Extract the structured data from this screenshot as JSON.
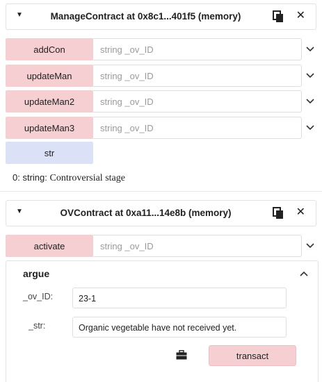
{
  "contract1": {
    "title": "ManageContract at 0x8c1...401f5 (memory)",
    "functions": [
      {
        "label": "addCon",
        "placeholder": "string _ov_ID"
      },
      {
        "label": "updateMan",
        "placeholder": "string _ov_ID"
      },
      {
        "label": "updateMan2",
        "placeholder": "string _ov_ID"
      },
      {
        "label": "updateMan3",
        "placeholder": "string _ov_ID"
      }
    ],
    "call_button": {
      "label": "str"
    },
    "output": {
      "prefix": "0: string:",
      "value": "Controversial  stage"
    }
  },
  "contract2": {
    "title": "OVContract at 0xa11...14e8b (memory)",
    "function": {
      "label": "activate",
      "placeholder": "string _ov_ID"
    },
    "expanded": {
      "name": "argue",
      "params": [
        {
          "label": "_ov_ID:",
          "value": "23-1"
        },
        {
          "label": "_str:",
          "value": "Organic vegetable have not received yet."
        }
      ],
      "transact_label": "transact"
    }
  },
  "icons": {
    "caret": "caret-down-icon",
    "copy": "copy-icon",
    "close": "close-icon",
    "chevron": "chevron-down-icon",
    "chevron_up": "chevron-up-icon",
    "briefcase": "briefcase-icon"
  },
  "colors": {
    "transact_button": "#f5cfd1",
    "call_button": "#dbe2f8"
  }
}
